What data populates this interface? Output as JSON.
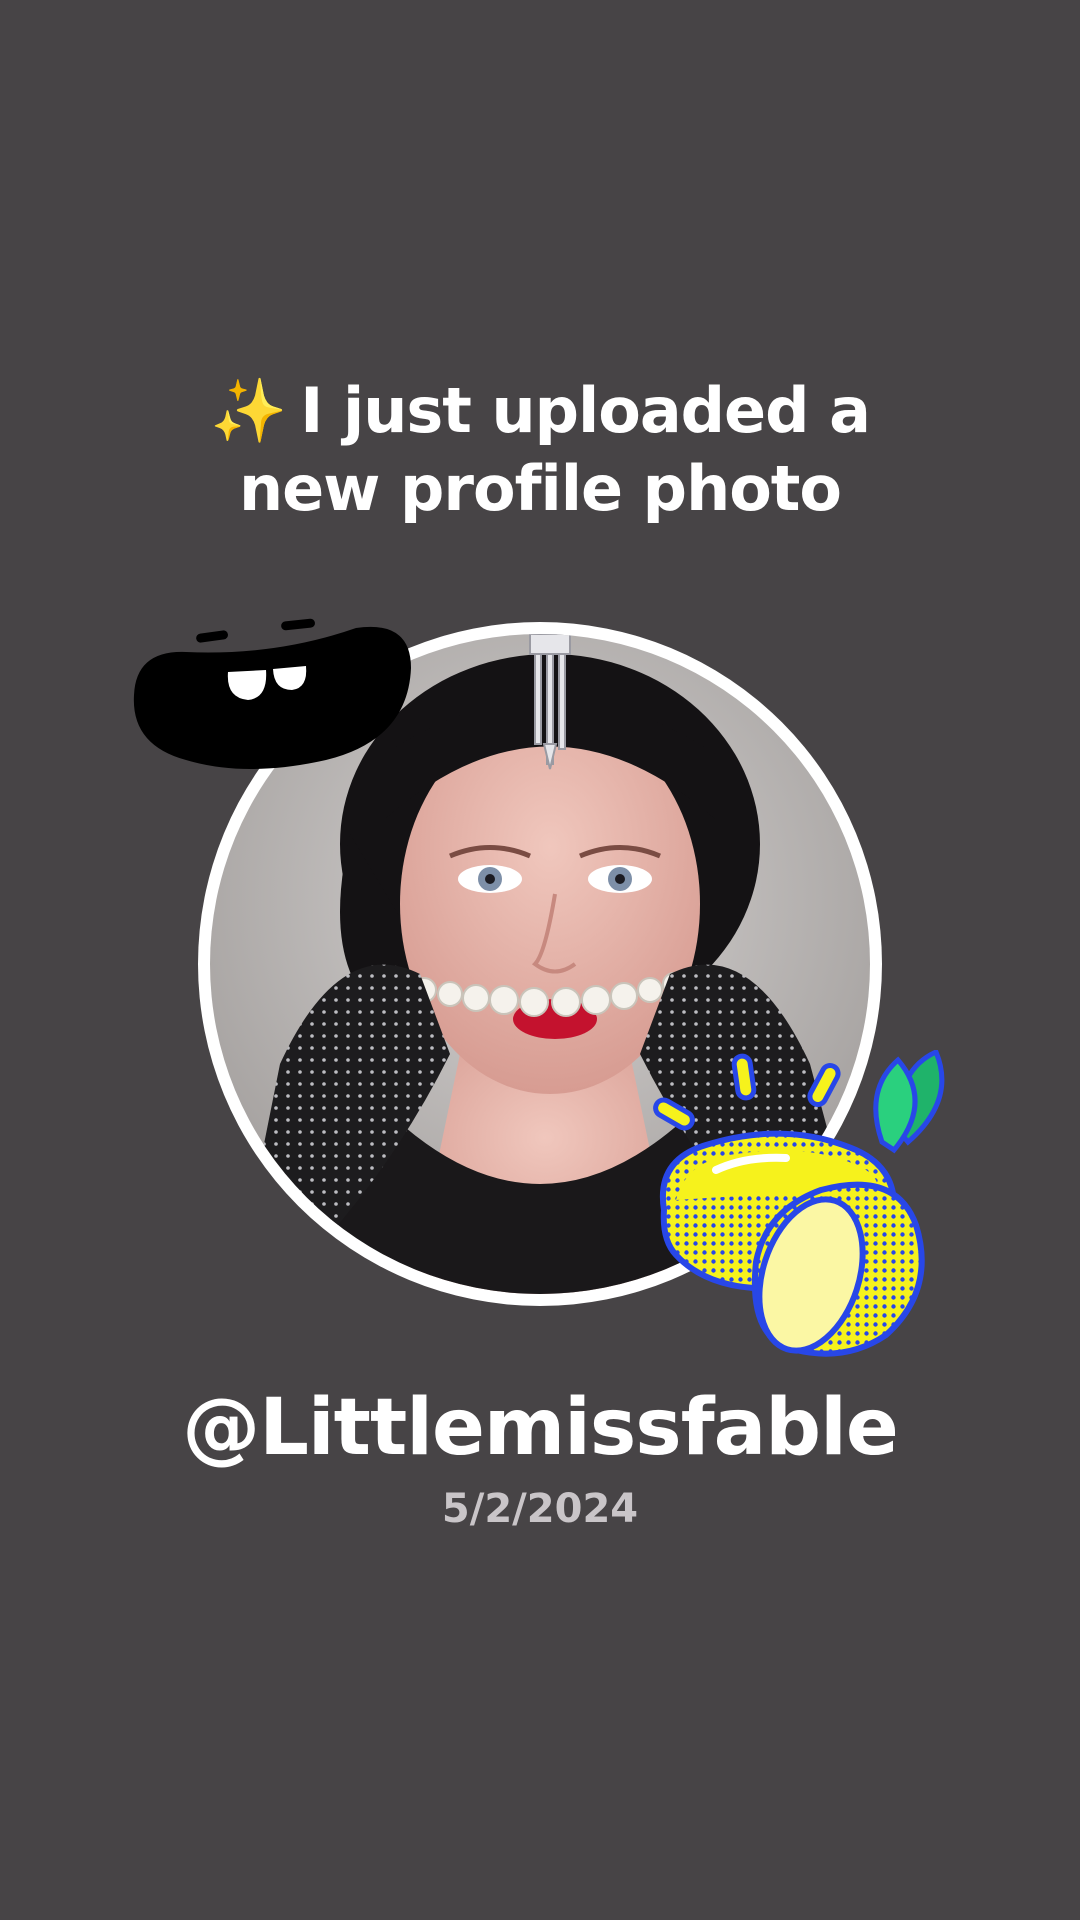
{
  "post": {
    "headline_emoji": "✨",
    "headline": "I just uploaded a new profile photo",
    "username": "@Littlemissfable",
    "date": "5/2/2024"
  },
  "stickers": {
    "top_left": "laughing-mouth-sticker",
    "bottom_right": "lemon-sticker"
  },
  "colors": {
    "background": "#474446",
    "text": "#ffffff",
    "date_text": "#c9c5c8",
    "ring": "#ffffff",
    "lemon_yellow": "#f6f21c",
    "lemon_outline": "#2847e8",
    "leaf_green": "#1fb36a"
  }
}
